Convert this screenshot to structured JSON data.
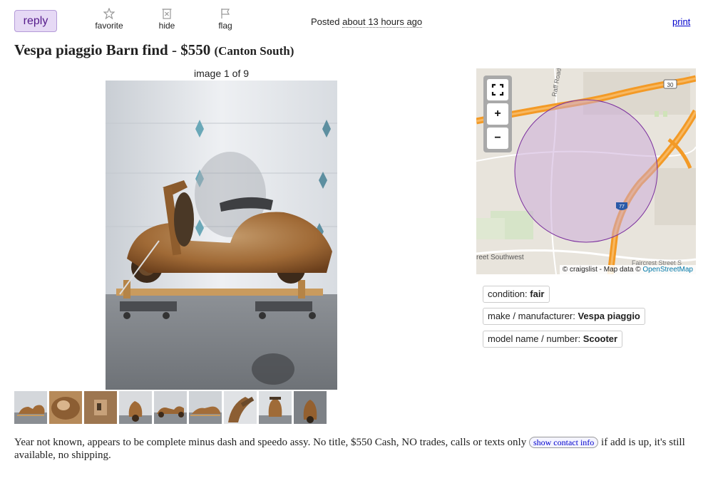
{
  "toolbar": {
    "reply_label": "reply",
    "favorite_label": "favorite",
    "hide_label": "hide",
    "flag_label": "flag",
    "posted_prefix": "Posted",
    "posted_ago": "about 13 hours ago",
    "print_label": "print"
  },
  "posting": {
    "title": "Vespa piaggio Barn find",
    "separator": " - ",
    "price": "$550",
    "location": "(Canton South)"
  },
  "gallery": {
    "counter": "image 1 of 9",
    "thumbnail_count": 9,
    "selected_index": 1
  },
  "map": {
    "labels": {
      "road_raff": "Raff Road",
      "route_30": "30",
      "route_77": "77",
      "street_southwest": "reet Southwest",
      "street_faircrest": "Faircrest Street S"
    },
    "attribution_prefix": "© craigslist - Map data ©",
    "attribution_link": "OpenStreetMap",
    "zoom_in": "+",
    "zoom_out": "−",
    "colors": {
      "radius_fill": "#c9a7d8",
      "radius_stroke": "#7b2f9e",
      "highway": "#f39a26"
    }
  },
  "attributes": [
    {
      "key": "condition: ",
      "value": "fair"
    },
    {
      "key": "make / manufacturer: ",
      "value": "Vespa piaggio"
    },
    {
      "key": "model name / number: ",
      "value": "Scooter"
    }
  ],
  "body": {
    "text_before": "Year not known, appears to be complete minus dash and speedo assy. No title, $550 Cash, NO trades, calls or texts only ",
    "contact_button": "show contact info",
    "text_after": " if add is up, it's still available, no shipping."
  }
}
